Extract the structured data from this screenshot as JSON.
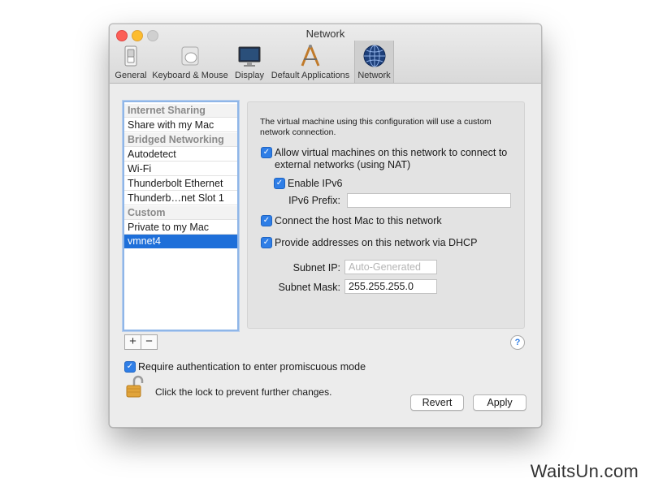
{
  "window": {
    "title": "Network",
    "toolbar": [
      {
        "label": "General",
        "icon": "switch-icon"
      },
      {
        "label": "Keyboard & Mouse",
        "icon": "mouse-icon"
      },
      {
        "label": "Display",
        "icon": "monitor-icon"
      },
      {
        "label": "Default Applications",
        "icon": "applications-icon"
      },
      {
        "label": "Network",
        "icon": "globe-icon",
        "selected": true
      }
    ]
  },
  "network_list": [
    {
      "label": "Internet Sharing",
      "type": "header"
    },
    {
      "label": "Share with my Mac",
      "type": "item"
    },
    {
      "label": "Bridged Networking",
      "type": "header"
    },
    {
      "label": "Autodetect",
      "type": "item"
    },
    {
      "label": "Wi-Fi",
      "type": "item"
    },
    {
      "label": "Thunderbolt Ethernet",
      "type": "item"
    },
    {
      "label": "Thunderb…net Slot 1",
      "type": "item"
    },
    {
      "label": "Custom",
      "type": "header"
    },
    {
      "label": "Private to my Mac",
      "type": "item"
    },
    {
      "label": "vmnet4",
      "type": "item",
      "selected": true
    }
  ],
  "list_controls": {
    "add": "+",
    "remove": "−"
  },
  "panel": {
    "description": "The virtual machine using this configuration will use a custom network connection.",
    "allow_nat": {
      "label": "Allow virtual machines on this network to connect to external networks (using NAT)",
      "checked": true
    },
    "enable_ipv6": {
      "label": "Enable IPv6",
      "checked": true
    },
    "ipv6_prefix": {
      "label": "IPv6 Prefix:",
      "value": ""
    },
    "connect_host": {
      "label": "Connect the host Mac to this network",
      "checked": true
    },
    "dhcp": {
      "label": "Provide addresses on this network via DHCP",
      "checked": true
    },
    "subnet_ip": {
      "label": "Subnet IP:",
      "placeholder": "Auto-Generated"
    },
    "subnet_mask": {
      "label": "Subnet Mask:",
      "value": "255.255.255.0"
    }
  },
  "help": "?",
  "promiscuous": {
    "label": "Require authentication to enter promiscuous mode",
    "checked": true
  },
  "lock": {
    "text": "Click the lock to prevent further changes."
  },
  "buttons": {
    "revert": "Revert",
    "apply": "Apply"
  },
  "watermark": "WaitsUn.com",
  "colors": {
    "accent": "#1e6fd9",
    "close": "#fc5f57",
    "minimize": "#fdbc2e"
  }
}
